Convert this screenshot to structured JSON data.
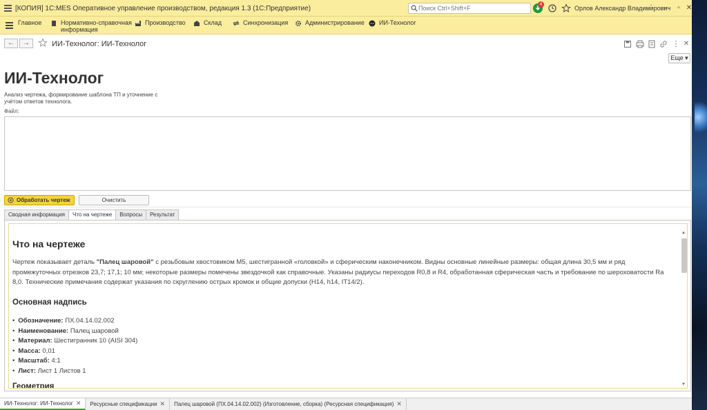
{
  "titlebar": {
    "title": "[КОПИЯ] 1С:MES Оперативное управление производством, редакция 1.3  (1С:Предприятие)",
    "search_placeholder": "Поиск Ctrl+Shift+F",
    "notif_count": "4",
    "user": "Орлов Александр Владимирович"
  },
  "menu": {
    "items": [
      {
        "label": "Главное"
      },
      {
        "label": "Нормативно-справочная\nинформация"
      },
      {
        "label": "Производство"
      },
      {
        "label": "Склад"
      },
      {
        "label": "Синхронизация"
      },
      {
        "label": "Администрирование"
      },
      {
        "label": "ИИ-Технолог"
      }
    ]
  },
  "form": {
    "title": "ИИ-Технолог: ИИ-Технолог",
    "more": "Еще ▾",
    "heading": "ИИ-Технолог",
    "subtitle": "Анализ чертежа, формирование шаблона ТП и уточнение с учётом ответов технолога.",
    "file_label": "Файл:",
    "process_btn": "Обработать чертеж",
    "clear_btn": "Очистить",
    "tabs": [
      "Сводная информация",
      "Что на чертеже",
      "Вопросы",
      "Результат"
    ]
  },
  "content": {
    "h2": "Что на чертеже",
    "p_before": "Чертеж показывает деталь ",
    "p_bold": "\"Палец шаровой\"",
    "p_after": " с резьбовым хвостовиком М5, шестигранной «головкой» и сферическим наконечником. Видны основные линейные размеры: общая длина 30,5 мм и ряд промежуточных отрезков 23,7; 17,1; 10 мм; некоторые размеры помечены звездочкой как справочные. Указаны радиусы переходов R0,8 и R4, обработанная сферическая часть и требование по шероховатости Ra 8,0. Технические примечания содержат указания по скруглению острых кромок и общие допуски (Н14, h14, IT14/2).",
    "h3": "Основная надпись",
    "items": [
      {
        "k": "Обозначение:",
        "v": " ПХ.04.14.02.002"
      },
      {
        "k": "Наименование:",
        "v": " Палец шаровой"
      },
      {
        "k": "Материал:",
        "v": " Шестигранник 10 (AISI 304)"
      },
      {
        "k": "Масса:",
        "v": " 0,01"
      },
      {
        "k": "Масштаб:",
        "v": " 4:1"
      },
      {
        "k": "Лист:",
        "v": " Лист 1 Листов 1"
      }
    ],
    "h3_next": "Геометрия"
  },
  "bottom_tabs": [
    "ИИ-Технолог: ИИ-Технолог",
    "Ресурсные спецификации",
    "Палец шаровой (ПХ.04.14.02.002) (Изготовление, сборка) (Ресурсная спецификация)"
  ],
  "colors": {
    "accent": "#fbed9e",
    "button": "#f5d33a",
    "notif": "#1f9a3c"
  }
}
